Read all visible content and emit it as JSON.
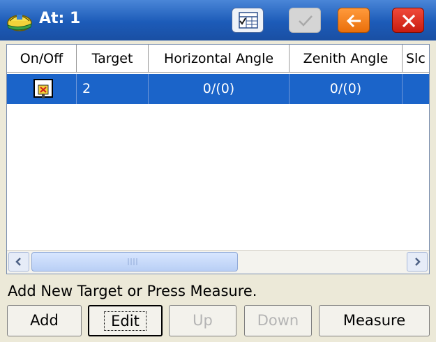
{
  "window": {
    "title": "At: 1",
    "icon": "helmet-logo-icon"
  },
  "title_buttons": [
    {
      "name": "table-view",
      "icon": "table-check-icon"
    },
    {
      "name": "ok",
      "icon": "check-icon",
      "enabled": false
    },
    {
      "name": "back",
      "icon": "arrow-left-icon",
      "color": "#ef7d1a"
    },
    {
      "name": "close",
      "icon": "close-icon",
      "color": "#dc2a1c"
    }
  ],
  "table": {
    "columns": [
      "On/Off",
      "Target",
      "Horizontal Angle",
      "Zenith Angle",
      "Slc"
    ],
    "rows": [
      {
        "on_off_icon": "target-on-checkbox-icon",
        "target": "2",
        "horizontal_angle": "0/(0)",
        "zenith_angle": "0/(0)",
        "slc": "",
        "selected": true
      }
    ]
  },
  "scrollbar": {
    "position": 0.0
  },
  "status": "Add New Target or Press Measure.",
  "buttons": {
    "add": "Add",
    "edit": "Edit",
    "up": "Up",
    "down": "Down",
    "measure": "Measure"
  },
  "colors": {
    "titlebar": "#1c5bb8",
    "selection": "#1b64c9",
    "background": "#ece9d8"
  }
}
